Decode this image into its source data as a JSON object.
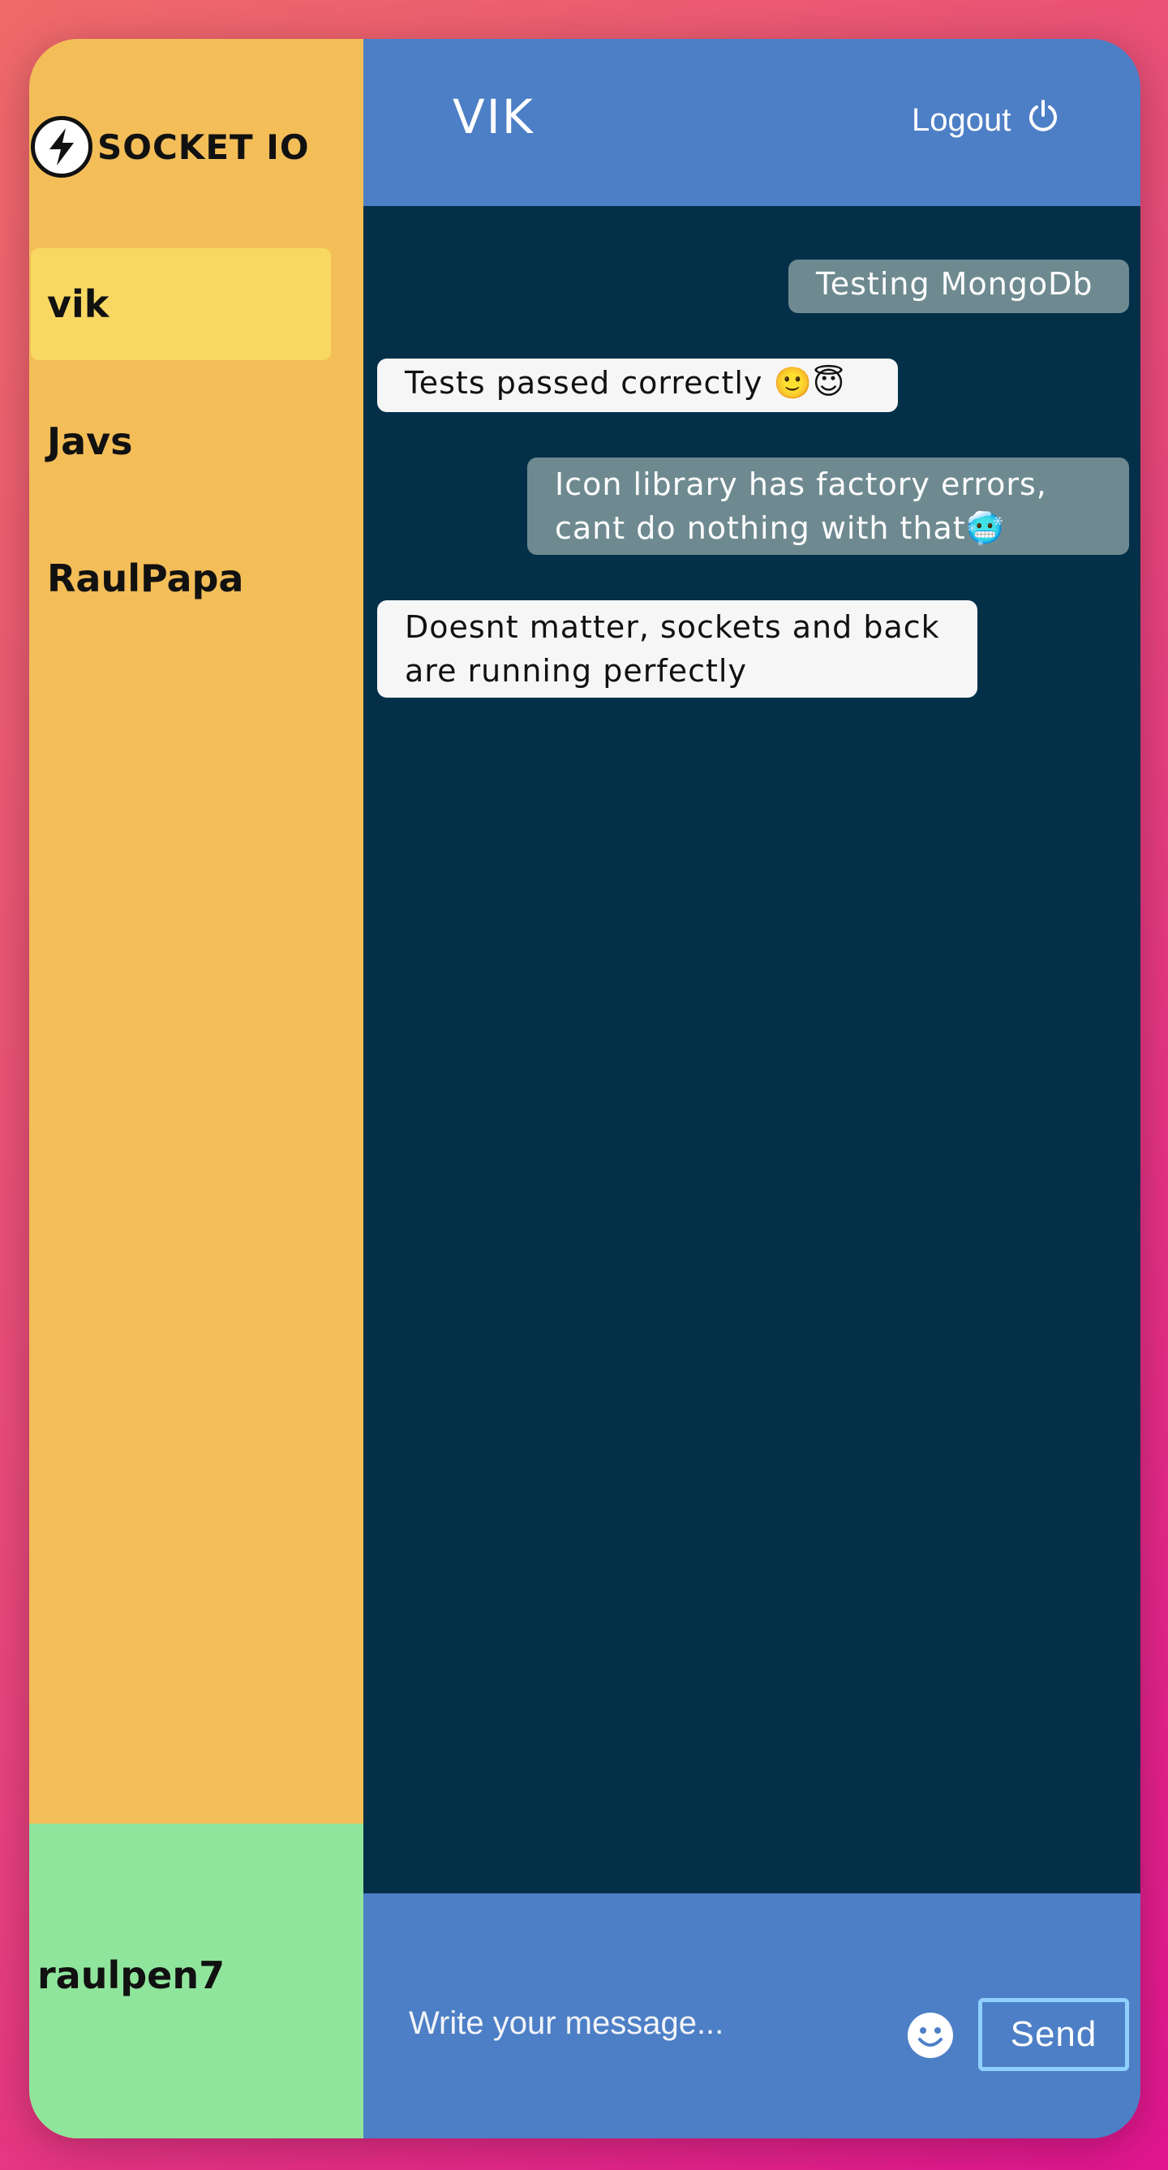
{
  "sidebar": {
    "logo_text": "SOCKET IO",
    "users": [
      {
        "name": "vik",
        "active": true
      },
      {
        "name": "Javs",
        "active": false
      },
      {
        "name": "RaulPapa",
        "active": false
      }
    ],
    "current_user": "raulpen7"
  },
  "header": {
    "title": "VIK",
    "logout_label": "Logout"
  },
  "messages": [
    {
      "text": "Testing MongoDb",
      "type": "sent"
    },
    {
      "text": "Tests passed correctly 🙂😇",
      "type": "received"
    },
    {
      "text": "Icon library has factory errors, cant do nothing with that🥶",
      "type": "sent"
    },
    {
      "text": "Doesnt matter, sockets and back are running perfectly",
      "type": "received"
    }
  ],
  "composer": {
    "placeholder": "Write your message...",
    "send_label": "Send"
  },
  "colors": {
    "sidebar": "#f3bd58",
    "active_user": "#f8d862",
    "current_user_panel": "#90e59c",
    "header": "#4d7fc6",
    "chat_background": "#033048",
    "sent_bubble": "#6e8a90",
    "received_bubble": "#f6f6f7",
    "send_border": "#8fd0ff"
  },
  "icons": {
    "logo": "lightning-bolt-icon",
    "logout": "power-icon",
    "emoji": "smiley-icon"
  }
}
